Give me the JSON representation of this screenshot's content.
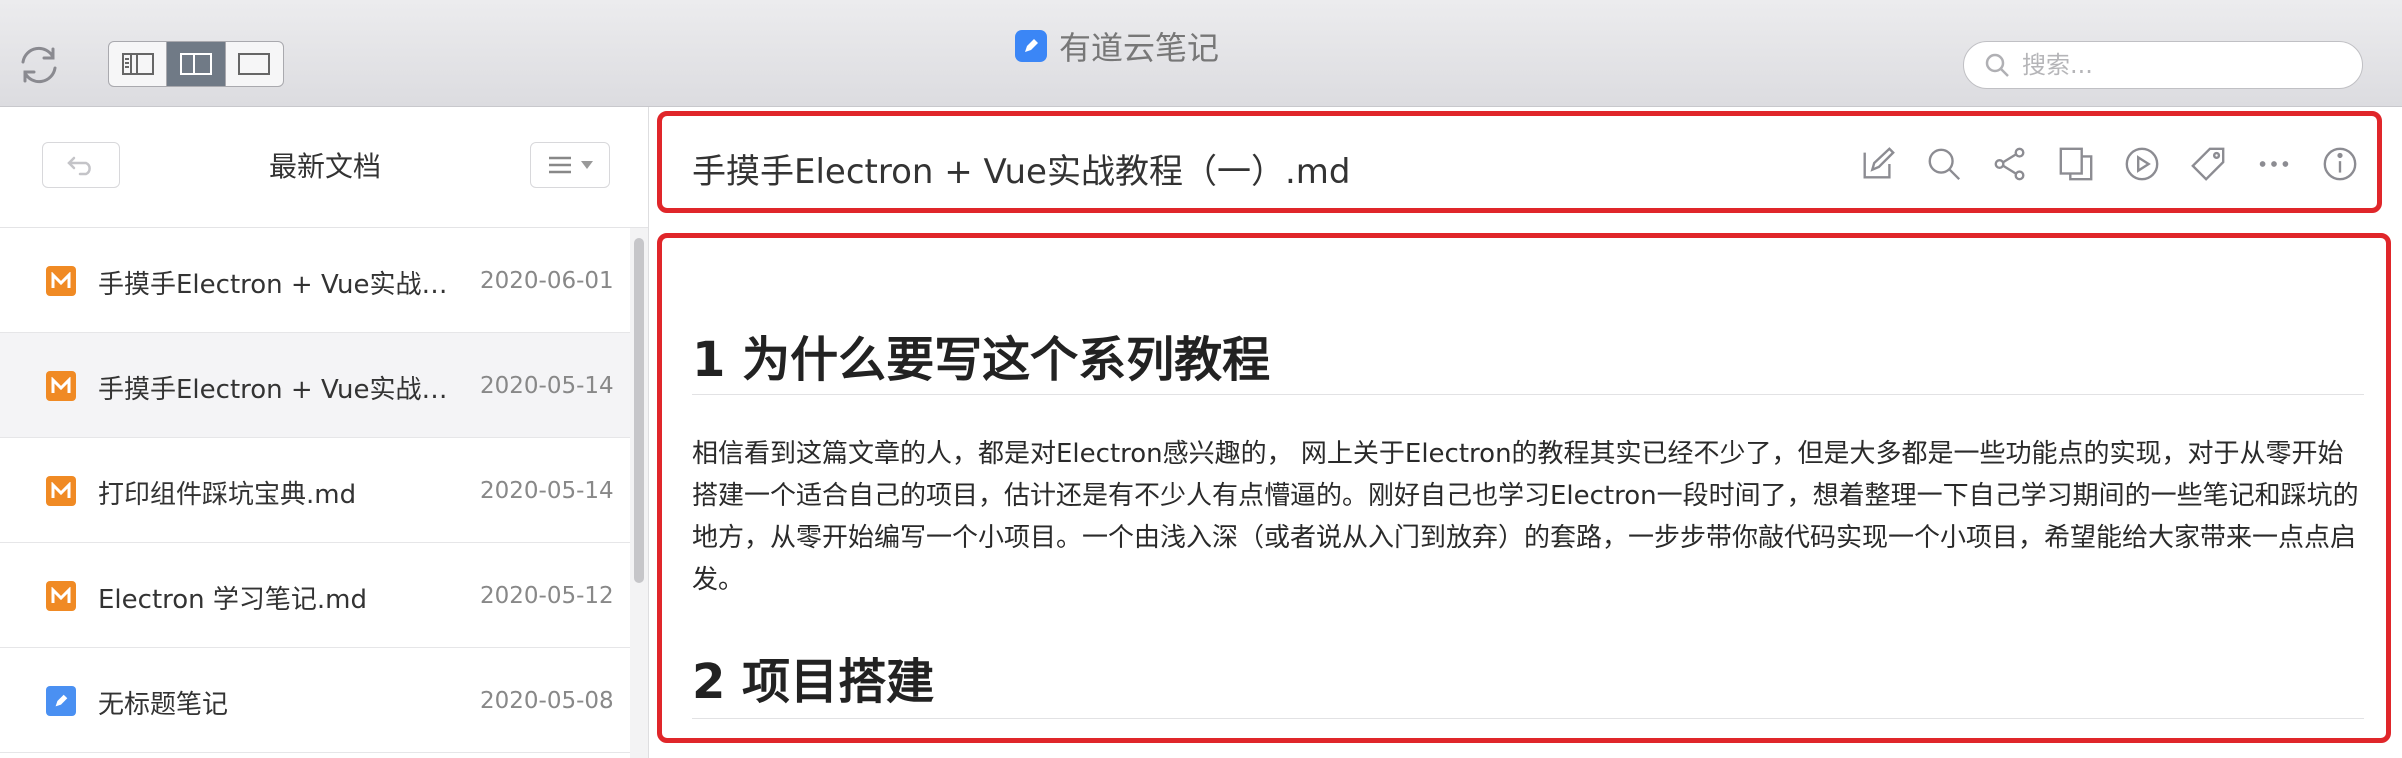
{
  "app": {
    "title": "有道云笔记"
  },
  "search": {
    "placeholder": "搜索..."
  },
  "left_panel": {
    "title": "最新文档",
    "documents": [
      {
        "name": "手摸手Electron + Vue实战教…",
        "date": "2020-06-01",
        "type": "markdown"
      },
      {
        "name": "手摸手Electron + Vue实战教…",
        "date": "2020-05-14",
        "type": "markdown"
      },
      {
        "name": "打印组件踩坑宝典.md",
        "date": "2020-05-14",
        "type": "markdown"
      },
      {
        "name": "Electron 学习笔记.md",
        "date": "2020-05-12",
        "type": "markdown"
      },
      {
        "name": "无标题笔记",
        "date": "2020-05-08",
        "type": "note"
      }
    ]
  },
  "document": {
    "title": "手摸手Electron + Vue实战教程（一）.md",
    "heading1": "1 为什么要写这个系列教程",
    "paragraph": "相信看到这篇文章的人，都是对Electron感兴趣的， 网上关于Electron的教程其实已经不少了，但是大多都是一些功能点的实现，对于从零开始搭建一个适合自己的项目，估计还是有不少人有点懵逼的。刚好自己也学习Electron一段时间了，想着整理一下自己学习期间的一些笔记和踩坑的地方，从零开始编写一个小项目。一个由浅入深（或者说从入门到放弃）的套路，一步步带你敲代码实现一个小项目，希望能给大家带来一点点启发。",
    "heading2": "2 项目搭建"
  },
  "toolbar_icons": [
    "edit-icon",
    "search-icon",
    "share-icon",
    "copy-icon",
    "play-icon",
    "tag-icon",
    "more-icon",
    "info-icon"
  ],
  "colors": {
    "accent_red": "#e0262a",
    "markdown_icon": "#f08a24",
    "note_icon": "#4a90f2",
    "logo_blue": "#3b86f6"
  }
}
